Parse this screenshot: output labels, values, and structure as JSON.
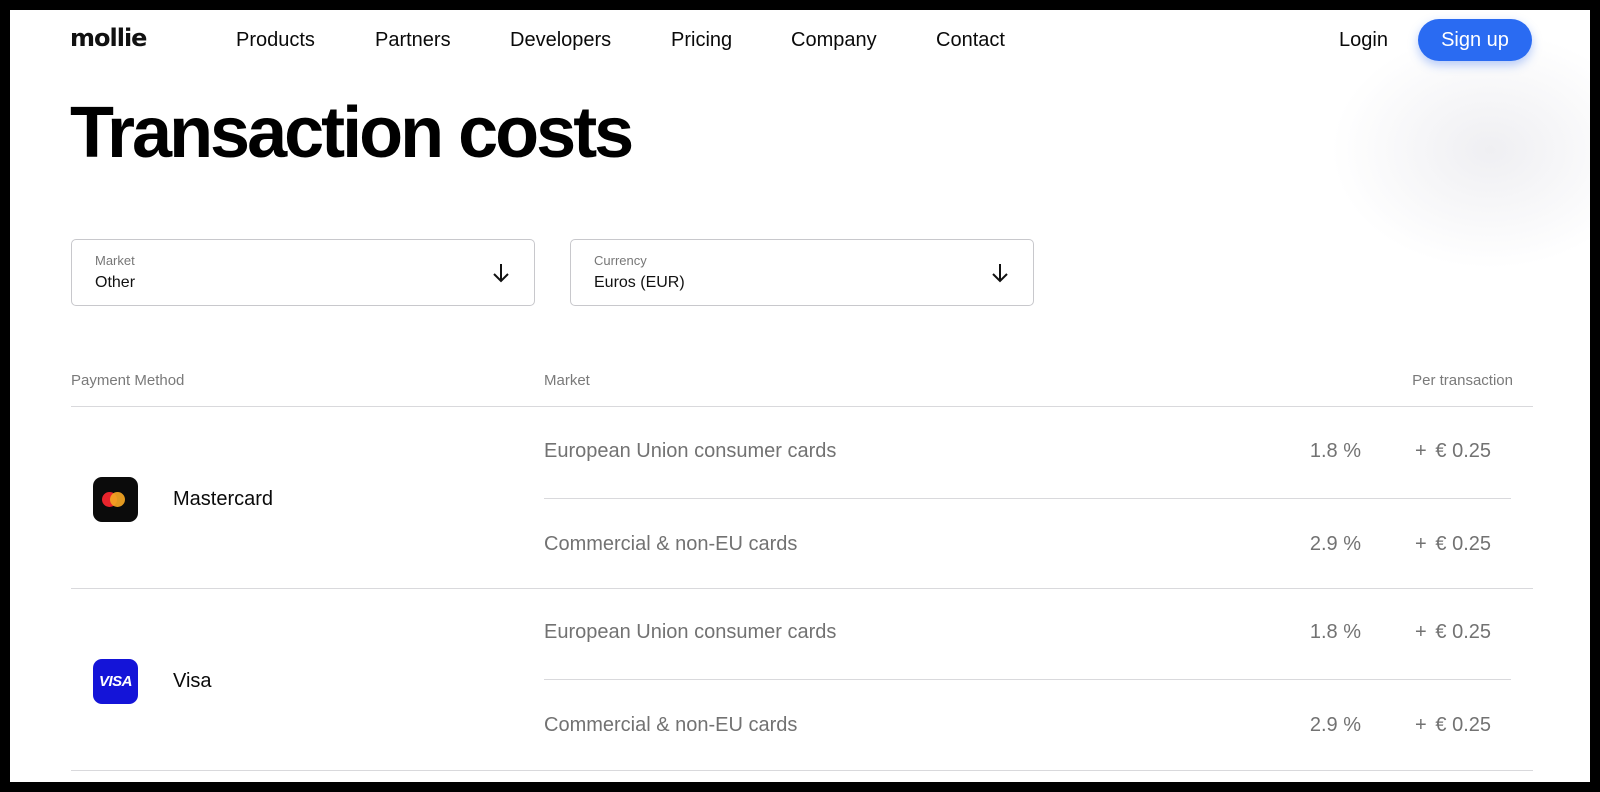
{
  "nav": {
    "logo": "mollie",
    "links": [
      "Products",
      "Partners",
      "Developers",
      "Pricing",
      "Company",
      "Contact"
    ],
    "login": "Login",
    "signup": "Sign up"
  },
  "page_title": "Transaction costs",
  "filters": {
    "market": {
      "label": "Market",
      "value": "Other"
    },
    "currency": {
      "label": "Currency",
      "value": "Euros (EUR)"
    }
  },
  "table": {
    "headers": {
      "method": "Payment Method",
      "market": "Market",
      "per_transaction": "Per transaction"
    },
    "methods": [
      {
        "name": "Mastercard",
        "icon": "mastercard-logo-icon",
        "rows": [
          {
            "market": "European Union consumer cards",
            "percent": "1.8 %",
            "plus": "+",
            "fixed": "€ 0.25"
          },
          {
            "market": "Commercial & non-EU cards",
            "percent": "2.9 %",
            "plus": "+",
            "fixed": "€ 0.25"
          }
        ]
      },
      {
        "name": "Visa",
        "icon": "visa-logo-icon",
        "badge_text": "VISA",
        "rows": [
          {
            "market": "European Union consumer cards",
            "percent": "1.8 %",
            "plus": "+",
            "fixed": "€ 0.25"
          },
          {
            "market": "Commercial & non-EU cards",
            "percent": "2.9 %",
            "plus": "+",
            "fixed": "€ 0.25"
          }
        ]
      }
    ]
  },
  "colors": {
    "accent": "#2a6bf2",
    "mastercard_bg": "#0b0b0b",
    "visa_bg": "#1414d8",
    "muted_text": "#727272"
  }
}
